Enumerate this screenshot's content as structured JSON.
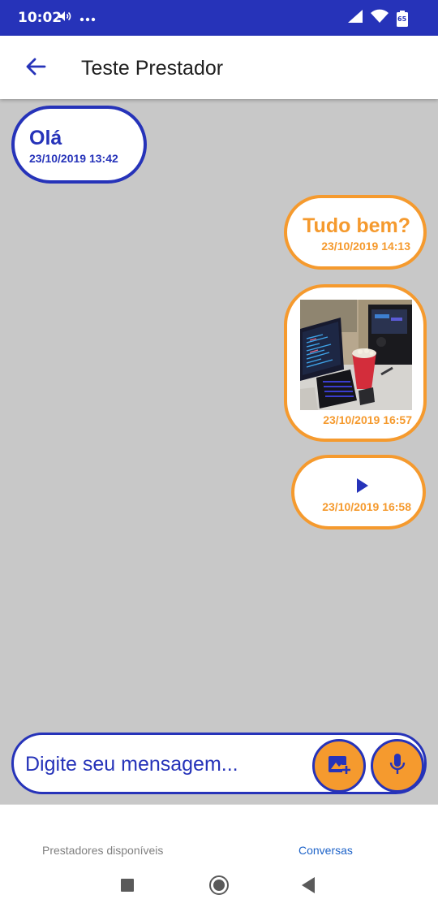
{
  "status_bar": {
    "time": "10:02",
    "battery": "65",
    "icons": [
      "volume-icon",
      "more-dots-icon",
      "signal-icon",
      "wifi-icon",
      "battery-icon"
    ]
  },
  "app_bar": {
    "title": "Teste Prestador",
    "back_icon": "arrow-left-icon"
  },
  "messages": [
    {
      "direction": "received",
      "type": "text",
      "text": "Olá",
      "time": "23/10/2019 13:42"
    },
    {
      "direction": "sent",
      "type": "text",
      "text": "Tudo bem?",
      "time": "23/10/2019 14:13"
    },
    {
      "direction": "sent",
      "type": "image",
      "time": "23/10/2019 16:57"
    },
    {
      "direction": "sent",
      "type": "audio",
      "time": "23/10/2019 16:58"
    }
  ],
  "composer": {
    "placeholder": "Digite seu mensagem...",
    "value": "",
    "image_button_icon": "add-photo-icon",
    "mic_button_icon": "microphone-icon"
  },
  "bottom_tabs": [
    {
      "label": "Prestadores disponíveis",
      "active": false
    },
    {
      "label": "Conversas",
      "active": true
    }
  ],
  "colors": {
    "primary": "#2633b9",
    "accent": "#f59a2e",
    "chat_background": "#c8c8c8",
    "tab_active": "#1e63c8"
  }
}
